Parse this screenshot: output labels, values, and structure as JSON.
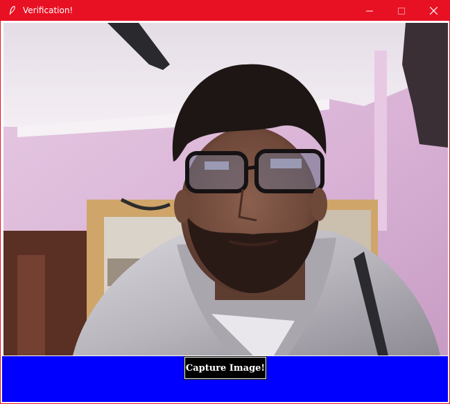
{
  "window": {
    "title": "Verification!",
    "titlebar_color": "#e81123",
    "icons": {
      "app": "feather-icon",
      "minimize": "minimize-icon",
      "maximize": "maximize-icon",
      "close": "close-icon"
    }
  },
  "camera": {
    "feed_description_icon": "webcam-feed"
  },
  "controls_bar": {
    "background": "#0000ff",
    "capture_label": "Capture Image!"
  }
}
